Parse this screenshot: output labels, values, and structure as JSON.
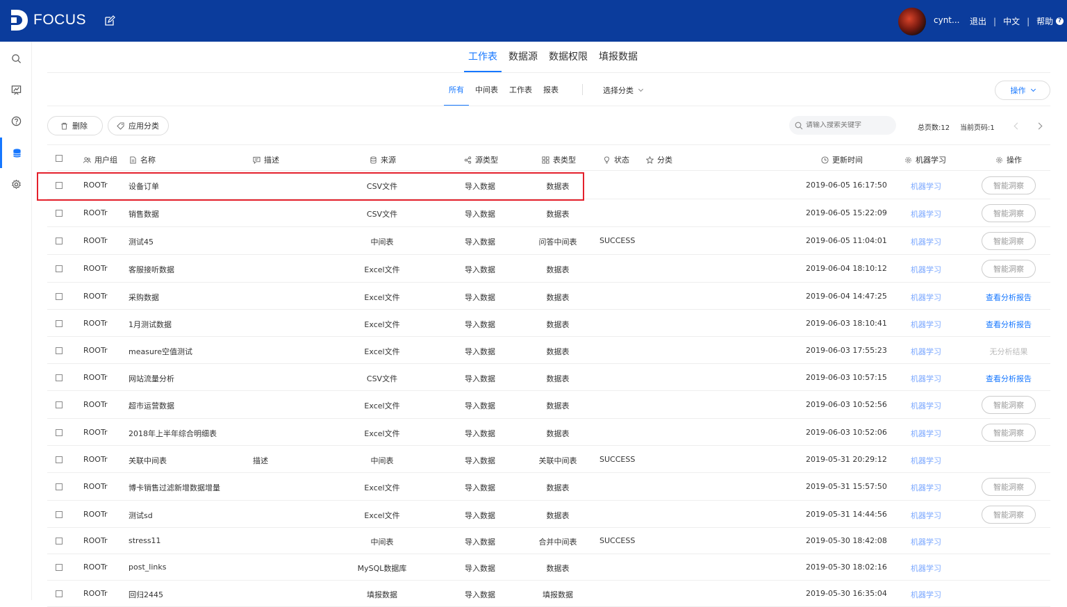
{
  "app": {
    "logo_text": "FOCUS",
    "user_name": "cynt...",
    "logout": "退出",
    "language": "中文",
    "help": "帮助"
  },
  "sidebar": {
    "items": [
      "search-icon",
      "board-icon",
      "help-icon",
      "data-icon",
      "settings-icon"
    ],
    "active_index": 3
  },
  "main_tabs": [
    "工作表",
    "数据源",
    "数据权限",
    "填报数据"
  ],
  "sub_tabs": [
    "所有",
    "中间表",
    "工作表",
    "报表"
  ],
  "category_select": "选择分类",
  "ops_button": "操作",
  "toolbar": {
    "delete": "删除",
    "apply_category": "应用分类"
  },
  "search": {
    "placeholder": "请输入搜索关键字"
  },
  "pager": {
    "total_pages": "总页数:12",
    "current_page": "当前页码:1"
  },
  "table": {
    "headers": {
      "user_group": "用户组",
      "name": "名称",
      "description": "描述",
      "source": "来源",
      "source_type": "源类型",
      "table_type": "表类型",
      "status": "状态",
      "category": "分类",
      "updated": "更新时间",
      "ml": "机器学习",
      "ops": "操作"
    },
    "rows": [
      {
        "group": "ROOTr",
        "name": "设备订单",
        "desc": "",
        "source": "CSV文件",
        "src_type": "导入数据",
        "tbl_type": "数据表",
        "status": "",
        "updated": "2019-06-05 16:17:50",
        "ml": "机器学习",
        "op": "智能洞察",
        "op_kind": "button"
      },
      {
        "group": "ROOTr",
        "name": "销售数据",
        "desc": "",
        "source": "CSV文件",
        "src_type": "导入数据",
        "tbl_type": "数据表",
        "status": "",
        "updated": "2019-06-05 15:22:09",
        "ml": "机器学习",
        "op": "智能洞察",
        "op_kind": "button"
      },
      {
        "group": "ROOTr",
        "name": "测试45",
        "desc": "",
        "source": "中间表",
        "src_type": "导入数据",
        "tbl_type": "问答中间表",
        "status": "SUCCESS",
        "updated": "2019-06-05 11:04:01",
        "ml": "机器学习",
        "op": "智能洞察",
        "op_kind": "button"
      },
      {
        "group": "ROOTr",
        "name": "客服接听数据",
        "desc": "",
        "source": "Excel文件",
        "src_type": "导入数据",
        "tbl_type": "数据表",
        "status": "",
        "updated": "2019-06-04 18:10:12",
        "ml": "机器学习",
        "op": "智能洞察",
        "op_kind": "button"
      },
      {
        "group": "ROOTr",
        "name": "采购数据",
        "desc": "",
        "source": "Excel文件",
        "src_type": "导入数据",
        "tbl_type": "数据表",
        "status": "",
        "updated": "2019-06-04 14:47:25",
        "ml": "机器学习",
        "op": "查看分析报告",
        "op_kind": "link"
      },
      {
        "group": "ROOTr",
        "name": "1月测试数据",
        "desc": "",
        "source": "Excel文件",
        "src_type": "导入数据",
        "tbl_type": "数据表",
        "status": "",
        "updated": "2019-06-03 18:10:41",
        "ml": "机器学习",
        "op": "查看分析报告",
        "op_kind": "link"
      },
      {
        "group": "ROOTr",
        "name": "measure空值测试",
        "desc": "",
        "source": "Excel文件",
        "src_type": "导入数据",
        "tbl_type": "数据表",
        "status": "",
        "updated": "2019-06-03 17:55:23",
        "ml": "机器学习",
        "op": "无分析结果",
        "op_kind": "none"
      },
      {
        "group": "ROOTr",
        "name": "网站流量分析",
        "desc": "",
        "source": "CSV文件",
        "src_type": "导入数据",
        "tbl_type": "数据表",
        "status": "",
        "updated": "2019-06-03 10:57:15",
        "ml": "机器学习",
        "op": "查看分析报告",
        "op_kind": "link"
      },
      {
        "group": "ROOTr",
        "name": "超市运营数据",
        "desc": "",
        "source": "Excel文件",
        "src_type": "导入数据",
        "tbl_type": "数据表",
        "status": "",
        "updated": "2019-06-03 10:52:56",
        "ml": "机器学习",
        "op": "智能洞察",
        "op_kind": "button"
      },
      {
        "group": "ROOTr",
        "name": "2018年上半年综合明细表",
        "desc": "",
        "source": "Excel文件",
        "src_type": "导入数据",
        "tbl_type": "数据表",
        "status": "",
        "updated": "2019-06-03 10:52:06",
        "ml": "机器学习",
        "op": "智能洞察",
        "op_kind": "button"
      },
      {
        "group": "ROOTr",
        "name": "关联中间表",
        "desc": "描述",
        "source": "中间表",
        "src_type": "导入数据",
        "tbl_type": "关联中间表",
        "status": "SUCCESS",
        "updated": "2019-05-31 20:29:12",
        "ml": "机器学习",
        "op": "",
        "op_kind": "empty"
      },
      {
        "group": "ROOTr",
        "name": "博卡销售过滤新增数据增量",
        "desc": "",
        "source": "Excel文件",
        "src_type": "导入数据",
        "tbl_type": "数据表",
        "status": "",
        "updated": "2019-05-31 15:57:50",
        "ml": "机器学习",
        "op": "智能洞察",
        "op_kind": "button"
      },
      {
        "group": "ROOTr",
        "name": "测试sd",
        "desc": "",
        "source": "Excel文件",
        "src_type": "导入数据",
        "tbl_type": "数据表",
        "status": "",
        "updated": "2019-05-31 14:44:56",
        "ml": "机器学习",
        "op": "智能洞察",
        "op_kind": "button"
      },
      {
        "group": "ROOTr",
        "name": "stress11",
        "desc": "",
        "source": "中间表",
        "src_type": "导入数据",
        "tbl_type": "合并中间表",
        "status": "SUCCESS",
        "updated": "2019-05-30 18:42:08",
        "ml": "机器学习",
        "op": "",
        "op_kind": "empty"
      },
      {
        "group": "ROOTr",
        "name": "post_links",
        "desc": "",
        "source": "MySQL数据库",
        "src_type": "导入数据",
        "tbl_type": "数据表",
        "status": "",
        "updated": "2019-05-30 18:02:16",
        "ml": "机器学习",
        "op": "",
        "op_kind": "empty"
      },
      {
        "group": "ROOTr",
        "name": "回归2445",
        "desc": "",
        "source": "填报数据",
        "src_type": "导入数据",
        "tbl_type": "填报数据",
        "status": "",
        "updated": "2019-05-30 16:35:04",
        "ml": "机器学习",
        "op": "",
        "op_kind": "empty"
      }
    ]
  },
  "colors": {
    "topbar": "#0b3c9c",
    "accent": "#1677ff",
    "highlight_box": "#e4202b"
  }
}
